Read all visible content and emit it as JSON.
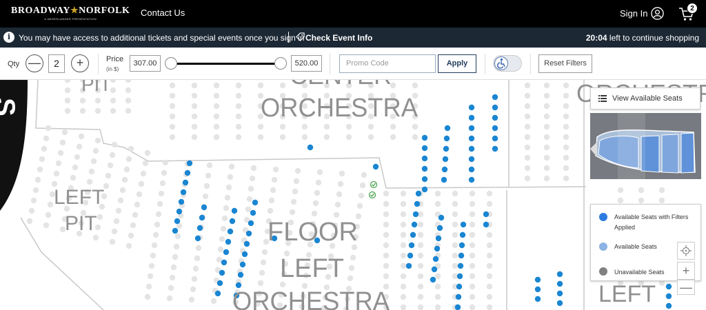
{
  "header": {
    "logo": {
      "left": "BROADWAY",
      "star": "★",
      "right": "NORFOLK",
      "sub": "A NEDERLANDER PRESENTATION"
    },
    "contact_label": "Contact Us",
    "signin_label": "Sign In",
    "cart_count": "2"
  },
  "notice": {
    "message": "You may have access to additional tickets and special events once you sign in",
    "check_event_label": "Check Event Info",
    "timer_value": "20:04",
    "timer_suffix": " left to continue shopping"
  },
  "filters": {
    "qty_label": "Qty",
    "qty_value": "2",
    "minus": "—",
    "plus": "+",
    "price_label": "Price",
    "price_unit": "(in $)",
    "price_min": "307.00",
    "price_max": "520.00",
    "promo_placeholder": "Promo Code",
    "apply_label": "Apply",
    "reset_label": "Reset Filters"
  },
  "map": {
    "sections": {
      "left_pit_top": "PIT",
      "left_pit_1": "LEFT",
      "left_pit_2": "PIT",
      "center_orch_top": "CENTER",
      "center_orch": "ORCHESTRA",
      "floor_1": "FLOOR",
      "floor_2": "LEFT",
      "floor_3": "ORCHESTRA",
      "right_orch": "ORCHESTRA",
      "right_left": "LEFT",
      "stage": "S"
    },
    "view_seats_label": "View Available Seats",
    "colors": {
      "available_filtered": "#1a86d2",
      "available": "#8cb3e3",
      "unavailable": "#e4e4e4",
      "section_line": "#c8c8c8"
    }
  },
  "legend": {
    "items": [
      {
        "label": "Available Seats with Filters Applied",
        "color": "#2c7be0"
      },
      {
        "label": "Available Seats",
        "color": "#8cb3e3"
      },
      {
        "label": "Unavailable Seats",
        "color": "#808080"
      }
    ]
  },
  "zoom": {
    "in": "+",
    "out": "—"
  }
}
